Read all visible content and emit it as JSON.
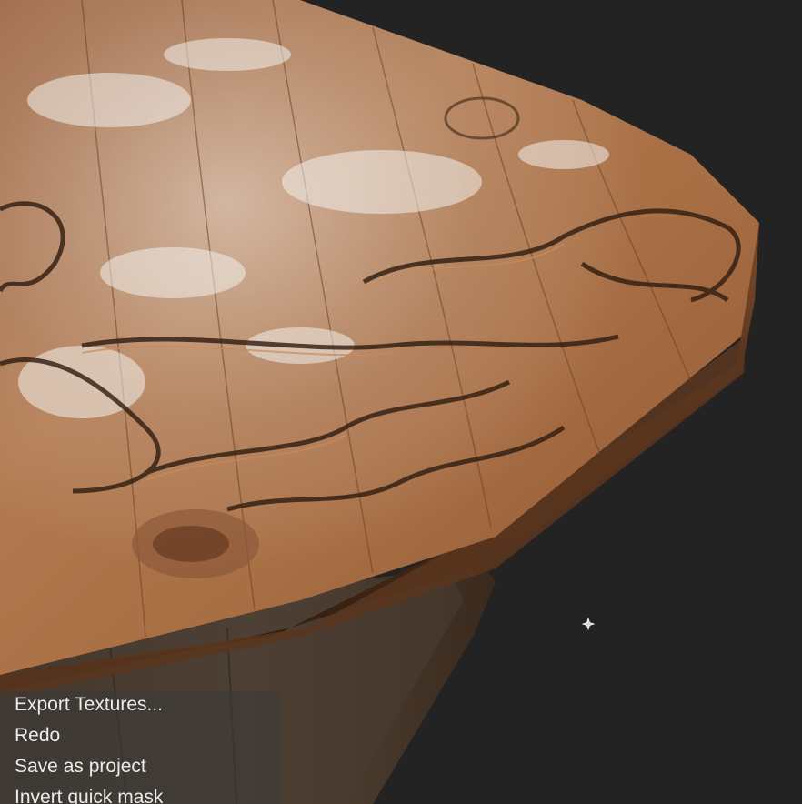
{
  "viewport": {
    "background_color": "#232323",
    "cursor_icon": "move-cursor-icon"
  },
  "context_menu": {
    "items": [
      {
        "label": "Export Textures..."
      },
      {
        "label": "Redo"
      },
      {
        "label": "Save as project"
      },
      {
        "label": "Invert quick mask"
      }
    ]
  },
  "colors": {
    "wood_light": "#b07448",
    "wood_mid": "#8a5431",
    "wood_dark": "#3a2416",
    "highlight": "#e8e4e0",
    "menu_text": "#ececec"
  }
}
